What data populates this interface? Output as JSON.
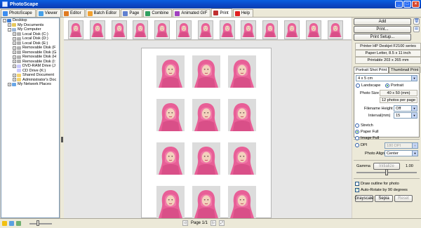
{
  "window": {
    "title": "PhotoScape",
    "controls": [
      "_",
      "□",
      "×"
    ]
  },
  "tabs": [
    {
      "label": "PhotoScape",
      "color": "#3d8df0"
    },
    {
      "label": "Viewer",
      "color": "#46a0e8"
    },
    {
      "label": "Editor",
      "color": "#e07a20"
    },
    {
      "label": "Batch Editor",
      "color": "#f0a030"
    },
    {
      "label": "Page",
      "color": "#6080d0"
    },
    {
      "label": "Combine",
      "color": "#30a060"
    },
    {
      "label": "Animated GIF",
      "color": "#a040c0"
    },
    {
      "label": "Print",
      "color": "#c03030",
      "active": true
    },
    {
      "label": "Help",
      "color": "#e02020"
    }
  ],
  "tree": [
    {
      "label": "Desktop",
      "level": 0,
      "expander": "-",
      "icon": "desk"
    },
    {
      "label": "My Documents",
      "level": 1,
      "expander": "+",
      "icon": "doc"
    },
    {
      "label": "My Computer",
      "level": 1,
      "expander": "-",
      "icon": "comp"
    },
    {
      "label": "Local Disk (C:)",
      "level": 2,
      "expander": "+",
      "icon": "disk"
    },
    {
      "label": "Local Disk (D:)",
      "level": 2,
      "expander": "+",
      "icon": "disk"
    },
    {
      "label": "Local Disk (E:)",
      "level": 2,
      "expander": "+",
      "icon": "disk"
    },
    {
      "label": "Removable Disk (F",
      "level": 2,
      "expander": "+",
      "icon": "disk"
    },
    {
      "label": "Removable Disk (G",
      "level": 2,
      "expander": "+",
      "icon": "disk"
    },
    {
      "label": "Removable Disk (H",
      "level": 2,
      "expander": "+",
      "icon": "disk"
    },
    {
      "label": "Removable Disk (I:",
      "level": 2,
      "expander": "+",
      "icon": "disk"
    },
    {
      "label": "DVD-RAM Drive (J",
      "level": 2,
      "expander": "+",
      "icon": "dvd"
    },
    {
      "label": "CD Drive (K:)",
      "level": 2,
      "expander": "",
      "icon": "dvd"
    },
    {
      "label": "Shared Document",
      "level": 2,
      "expander": "+",
      "icon": "fold"
    },
    {
      "label": "Administrator's Doc",
      "level": 2,
      "expander": "+",
      "icon": "fold"
    },
    {
      "label": "My Network Places",
      "level": 1,
      "expander": "+",
      "icon": "net"
    }
  ],
  "thumbnail_count": 13,
  "print_page": {
    "photos": 12,
    "columns": 3,
    "rows": 4
  },
  "pager": {
    "label": "Page 1/1",
    "prev": "◁",
    "next": "▷"
  },
  "right_panel": {
    "add_label": "Add",
    "print_label": "Print...",
    "print_setup_label": "Print Setup...",
    "printer": "Printer  HP Deskjet F2100 series",
    "paper": "Paper  Letter, 8.5 x 11 inch",
    "printable": "Printable  203 x 265 mm",
    "tab_portrait": "Portrait Shot Print",
    "tab_thumbnail": "Thumbnail Print",
    "size_select": "4 x 5 cm",
    "landscape_label": "Landscape",
    "portrait_label": "Portrait",
    "photo_size_label": "Photo Size",
    "photo_size_value": "40 x 50 (mm)",
    "photos_per_page": "12 photos per page",
    "filename_height_label": "Filename Height",
    "filename_height_value": "Off",
    "interval_label": "Interval(mm)",
    "interval_value": "15",
    "stretch_label": "Stretch",
    "paper_full_label": "Paper Full",
    "image_full_label": "Image Full",
    "dpi_label": "DPI",
    "dpi_value": "180 DPI",
    "photo_align_label": "Photo Align",
    "photo_align_value": "Center",
    "gamma_label": "Gamma",
    "gamma_button": "Initialize",
    "gamma_value": "1.00",
    "gamma_level": 0.5,
    "outline_label": "Draw outline for photo",
    "autorotate_label": "Auto-Rotate by 90 degrees",
    "grayscale_label": "Grayscale",
    "sepia_label": "Sepia",
    "reset_label": "Reset"
  }
}
